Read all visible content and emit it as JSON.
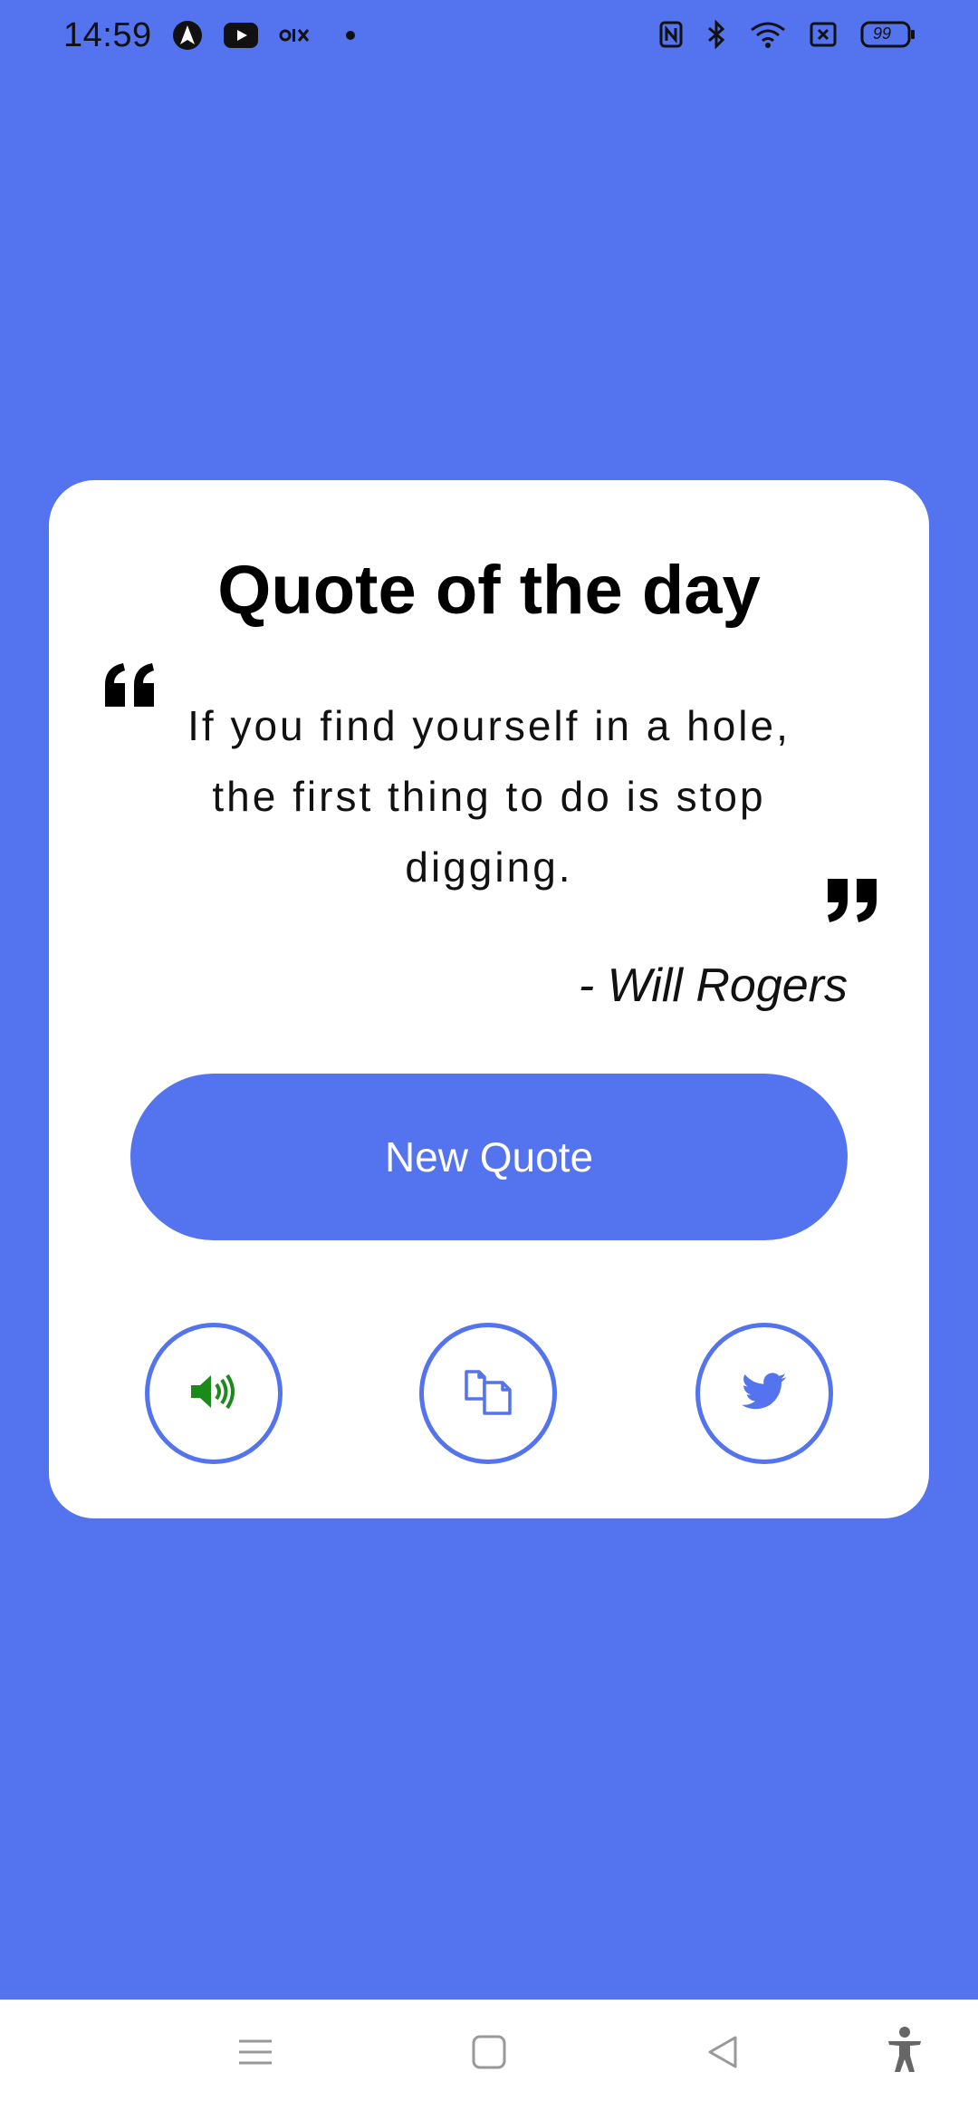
{
  "status_bar": {
    "time": "14:59",
    "left_icons": [
      "navigation-app-icon",
      "youtube-icon",
      "olx-icon",
      "notification-dot-icon"
    ],
    "right_icons": [
      "nfc-icon",
      "bluetooth-icon",
      "wifi-icon",
      "no-sim-icon",
      "battery-icon"
    ],
    "battery_level": "99"
  },
  "card": {
    "title": "Quote of the day",
    "quote": "If you find yourself in a hole, the first thing to do is stop digging.",
    "author": "- Will Rogers",
    "new_quote_label": "New Quote",
    "actions": [
      {
        "name": "speak",
        "icon": "speaker-icon",
        "color": "#1a8a1a"
      },
      {
        "name": "copy",
        "icon": "copy-icon",
        "color": "#5473ee"
      },
      {
        "name": "tweet",
        "icon": "twitter-icon",
        "color": "#5473ee"
      }
    ]
  },
  "colors": {
    "background": "#5473ee",
    "card": "#ffffff",
    "accent": "#5473ee",
    "speaker": "#1a8a1a"
  },
  "nav_bar": {
    "items": [
      "menu-icon",
      "home-icon",
      "back-icon",
      "accessibility-icon"
    ]
  }
}
